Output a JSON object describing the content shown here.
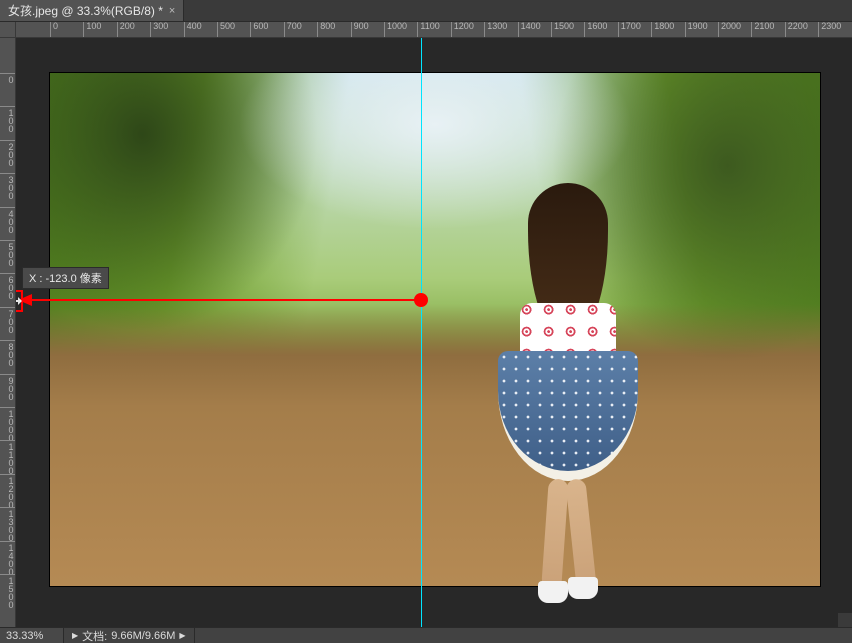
{
  "tab": {
    "title": "女孩.jpeg @ 33.3%(RGB/8) *"
  },
  "ruler": {
    "h_labels": [
      "0",
      "100",
      "200",
      "300",
      "400",
      "500",
      "600",
      "700",
      "800",
      "900",
      "1000",
      "1100",
      "1200",
      "1300",
      "1400",
      "1500",
      "1600",
      "1700",
      "1800",
      "1900",
      "2000",
      "2100",
      "2200",
      "2300"
    ],
    "v_labels": [
      "0",
      "100",
      "200",
      "300",
      "400",
      "500",
      "600",
      "700",
      "800",
      "900",
      "1000",
      "1100",
      "1200",
      "1300",
      "1400",
      "1500"
    ]
  },
  "guide": {
    "tooltip_prefix": "X :",
    "tooltip_value": "-123.0",
    "tooltip_unit": "像素"
  },
  "status": {
    "zoom": "33.33%",
    "doc_label": "文档:",
    "doc_value": "9.66M/9.66M"
  }
}
